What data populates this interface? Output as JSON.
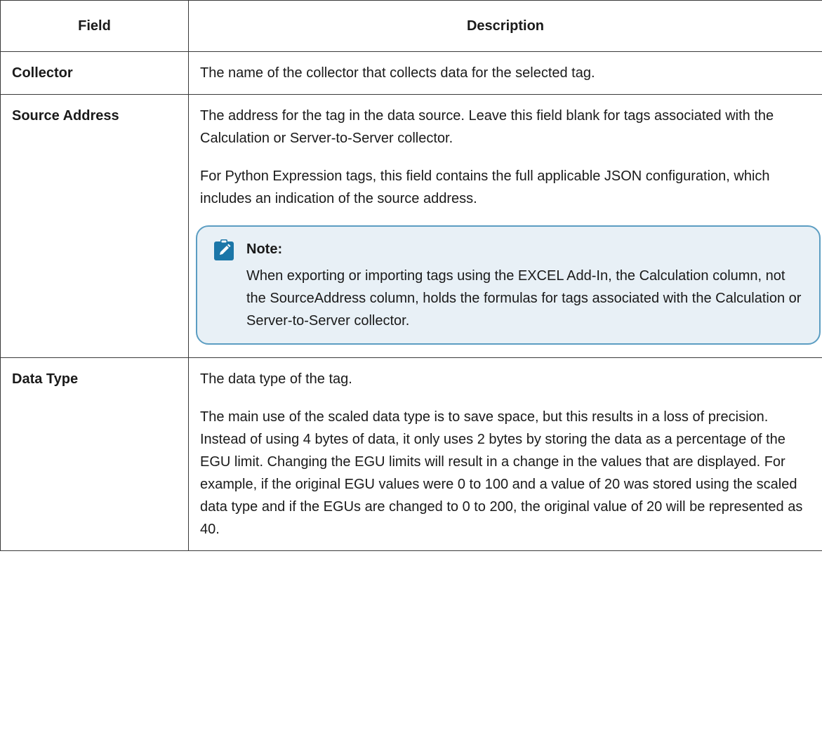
{
  "table": {
    "headers": {
      "field": "Field",
      "description": "Description"
    },
    "rows": [
      {
        "field": "Collector",
        "paragraphs": [
          "The name of the collector that collects data for the selected tag."
        ]
      },
      {
        "field": "Source Address",
        "paragraphs": [
          "The address for the tag in the data source. Leave this field blank for tags associated with the Calculation or Server-to-Server collector.",
          "For Python Expression tags, this field contains the full applicable JSON configuration, which includes an indication of the source address."
        ],
        "note": {
          "icon": "pencil-note-icon",
          "title": "Note:",
          "text": "When exporting or importing tags using the EXCEL Add-In, the Calculation column, not the SourceAddress column, holds the formulas for tags associated with the Calculation or Server-to-Server collector."
        }
      },
      {
        "field": "Data Type",
        "paragraphs": [
          "The data type of the tag.",
          "The main use of the scaled data type is to save space, but this results in a loss of precision. Instead of using 4 bytes of data, it only uses 2 bytes by storing the data as a percentage of the EGU limit. Changing the EGU limits will result in a change in the values that are displayed. For example, if the original EGU values were 0 to 100 and a value of 20 was stored using the scaled data type and if the EGUs are changed to 0 to 200, the original value of 20 will be represented as 40."
        ]
      }
    ]
  },
  "colors": {
    "note_border": "#5b9dc2",
    "note_background": "#e8f0f6",
    "note_icon": "#1b76a8",
    "table_border": "#3a3a3a"
  }
}
